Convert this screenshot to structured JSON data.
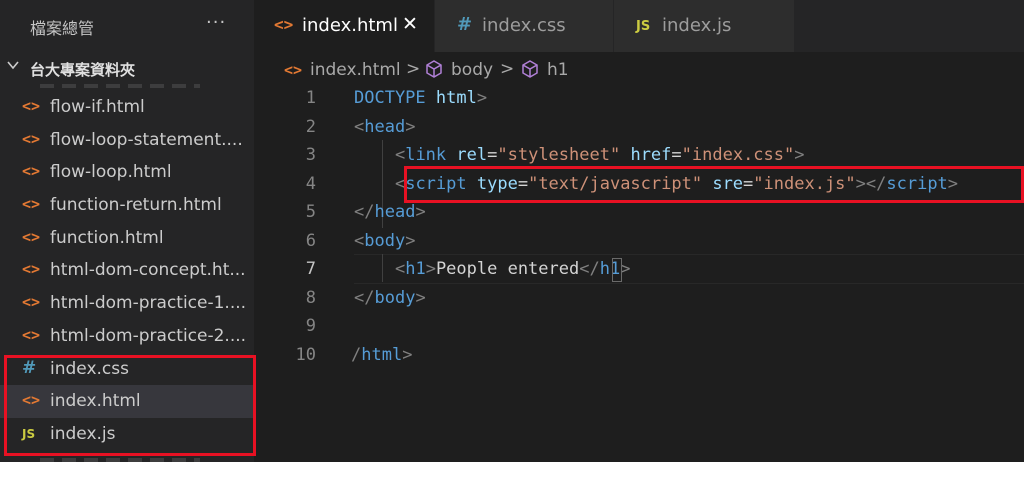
{
  "sidebar": {
    "title": "檔案總管",
    "more_label": "···",
    "folder_chevron": "chevron-down-icon",
    "folder_name": "台大專案資料夾",
    "files": [
      {
        "name": "flow-if.html",
        "type": "html",
        "icon_glyph": "<>"
      },
      {
        "name": "flow-loop-statement....",
        "type": "html",
        "icon_glyph": "<>"
      },
      {
        "name": "flow-loop.html",
        "type": "html",
        "icon_glyph": "<>"
      },
      {
        "name": "function-return.html",
        "type": "html",
        "icon_glyph": "<>"
      },
      {
        "name": "function.html",
        "type": "html",
        "icon_glyph": "<>"
      },
      {
        "name": "html-dom-concept.ht...",
        "type": "html",
        "icon_glyph": "<>"
      },
      {
        "name": "html-dom-practice-1....",
        "type": "html",
        "icon_glyph": "<>"
      },
      {
        "name": "html-dom-practice-2....",
        "type": "html",
        "icon_glyph": "<>"
      },
      {
        "name": "index.css",
        "type": "css",
        "icon_glyph": "#"
      },
      {
        "name": "index.html",
        "type": "html",
        "icon_glyph": "<>",
        "selected": true
      },
      {
        "name": "index.js",
        "type": "js",
        "icon_glyph": "JS"
      }
    ]
  },
  "tabs": [
    {
      "label": "index.html",
      "icon_glyph": "<>",
      "icon_color": "#e37933",
      "active": true,
      "close_glyph": "✕"
    },
    {
      "label": "index.css",
      "icon_glyph": "#",
      "icon_color": "#519aba",
      "active": false
    },
    {
      "label": "index.js",
      "icon_glyph": "JS",
      "icon_color": "#cbcb41",
      "active": false
    }
  ],
  "breadcrumb": {
    "file": "index.html",
    "file_icon_glyph": "<>",
    "sep": ">",
    "item1": "body",
    "item2": "h1",
    "cube_icon": "cube-icon"
  },
  "editor": {
    "line_numbers": [
      "1",
      "2",
      "3",
      "4",
      "5",
      "6",
      "7",
      "8",
      "9",
      "10"
    ],
    "current_line": "7",
    "lines": [
      [
        [
          "tag",
          "DOCTYPE"
        ],
        [
          "txt",
          " "
        ],
        [
          "attr",
          "html"
        ],
        [
          "br",
          ">"
        ]
      ],
      [
        [
          "br",
          "<"
        ],
        [
          "tag",
          "head"
        ],
        [
          "br",
          ">"
        ]
      ],
      [
        [
          "txt",
          "    "
        ],
        [
          "br",
          "<"
        ],
        [
          "tag",
          "link"
        ],
        [
          "txt",
          " "
        ],
        [
          "attr",
          "rel"
        ],
        [
          "txt",
          "="
        ],
        [
          "str",
          "\"stylesheet\""
        ],
        [
          "txt",
          " "
        ],
        [
          "attr",
          "href"
        ],
        [
          "txt",
          "="
        ],
        [
          "str",
          "\"index.css\""
        ],
        [
          "br",
          ">"
        ]
      ],
      [
        [
          "txt",
          "    "
        ],
        [
          "br",
          "<"
        ],
        [
          "tag",
          "script"
        ],
        [
          "txt",
          " "
        ],
        [
          "attr",
          "type"
        ],
        [
          "txt",
          "="
        ],
        [
          "str",
          "\"text/javascript\""
        ],
        [
          "txt",
          " "
        ],
        [
          "attr",
          "sre"
        ],
        [
          "txt",
          "="
        ],
        [
          "str",
          "\"index.js\""
        ],
        [
          "br",
          "></"
        ],
        [
          "tag",
          "script"
        ],
        [
          "br",
          ">"
        ]
      ],
      [
        [
          "br",
          "</"
        ],
        [
          "tag",
          "head"
        ],
        [
          "br",
          ">"
        ]
      ],
      [
        [
          "br",
          "<"
        ],
        [
          "tag",
          "body"
        ],
        [
          "br",
          ">"
        ]
      ],
      [
        [
          "txt",
          "    "
        ],
        [
          "br",
          "<"
        ],
        [
          "tag",
          "h1"
        ],
        [
          "br",
          ">"
        ],
        [
          "txt",
          "People entered"
        ],
        [
          "br",
          "</"
        ],
        [
          "tag",
          "h1"
        ],
        [
          "br",
          ">"
        ]
      ],
      [
        [
          "br",
          "</"
        ],
        [
          "tag",
          "body"
        ],
        [
          "br",
          ">"
        ]
      ],
      [],
      [
        [
          "br",
          "/"
        ],
        [
          "tag",
          "html"
        ],
        [
          "br",
          ">"
        ]
      ]
    ]
  },
  "colors": {
    "highlight_box": "#e81123",
    "editor_bg": "#1e1e1e",
    "sidebar_bg": "#252526"
  }
}
